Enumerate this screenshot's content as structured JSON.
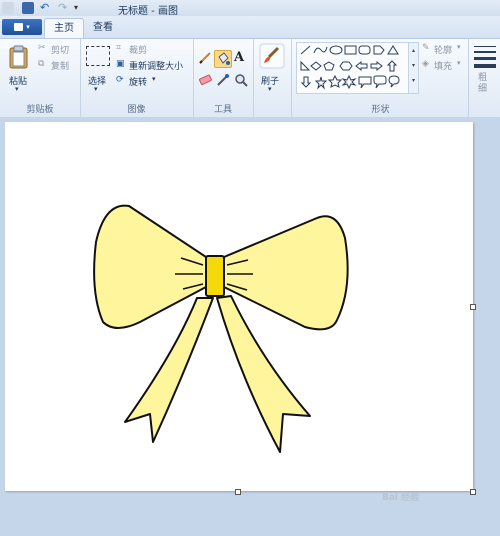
{
  "window": {
    "title": "无标题 - 画图"
  },
  "tabs": [
    {
      "label": "主页"
    },
    {
      "label": "查看"
    }
  ],
  "ribbon": {
    "clipboard": {
      "paste": "粘贴",
      "cut": "剪切",
      "copy": "复制",
      "group_label": "剪贴板"
    },
    "image": {
      "select": "选择",
      "crop": "裁剪",
      "resize": "重新调整大小",
      "rotate": "旋转",
      "group_label": "图像"
    },
    "tools": {
      "group_label": "工具"
    },
    "brushes": {
      "label": "刷子"
    },
    "shapes": {
      "outline": "轮廓",
      "fill": "填充",
      "group_label": "形状"
    },
    "size": {
      "label": "粗细"
    }
  },
  "colors": {
    "bow_fill": "#fff59d",
    "knot_fill": "#f5d90a",
    "accent": "#1f4f99"
  },
  "watermark": "Bai 经验"
}
